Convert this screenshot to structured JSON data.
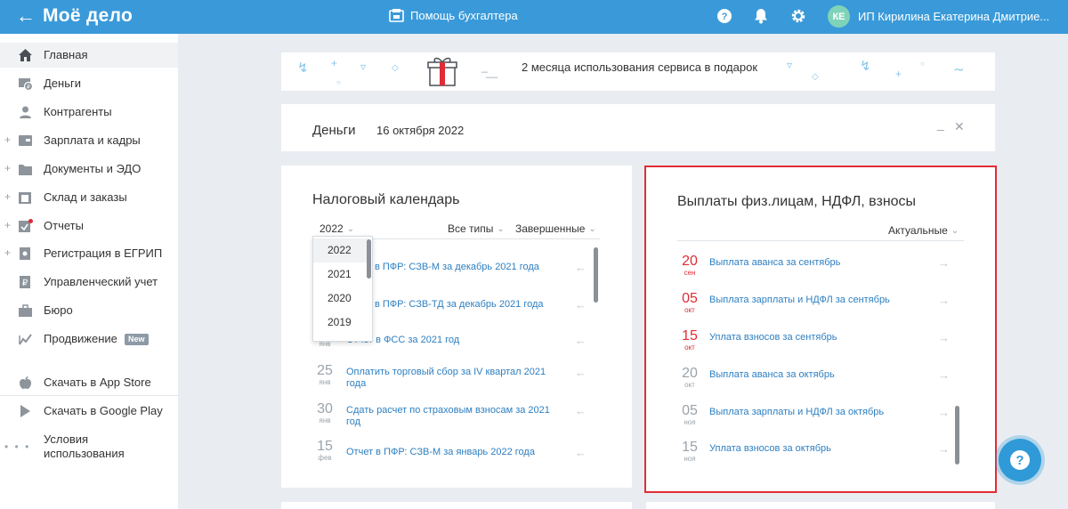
{
  "topbar": {
    "logo": "Моё дело",
    "helper_label": "Помощь бухгалтера",
    "user_initials": "КЕ",
    "user_name": "ИП Кирилина Екатерина Дмитрие..."
  },
  "sidebar": {
    "items": [
      {
        "label": "Главная"
      },
      {
        "label": "Деньги"
      },
      {
        "label": "Контрагенты"
      },
      {
        "label": "Зарплата и кадры"
      },
      {
        "label": "Документы и ЭДО"
      },
      {
        "label": "Склад и заказы"
      },
      {
        "label": "Отчеты"
      },
      {
        "label": "Регистрация в ЕГРИП"
      },
      {
        "label": "Управленческий учет"
      },
      {
        "label": "Бюро"
      },
      {
        "label": "Продвижение",
        "badge": "New"
      }
    ],
    "bottom_items": [
      {
        "label": "Скачать в App Store"
      },
      {
        "label": "Скачать в Google Play"
      },
      {
        "label_line1": "Условия",
        "label_line2": "использования"
      }
    ]
  },
  "banner": {
    "text": "2 месяца использования сервиса в подарок"
  },
  "money": {
    "title": "Деньги",
    "date": "16 октября 2022"
  },
  "tax_calendar": {
    "title": "Налоговый календарь",
    "year": "2022",
    "filter_types": "Все типы",
    "filter_status": "Завершенные",
    "year_options": [
      "2022",
      "2021",
      "2020",
      "2019"
    ],
    "rows": [
      {
        "text": "в ПФР: СЗВ-М за декабрь 2021 года"
      },
      {
        "text": "в ПФР: СЗВ-ТД за декабрь 2021 года"
      },
      {
        "month": "янв",
        "text": "Отчет в ФСС за 2021 год"
      },
      {
        "day": "25",
        "month": "янв",
        "text": "Оплатить торговый сбор за IV квартал 2021 года"
      },
      {
        "day": "30",
        "month": "янв",
        "text": "Сдать расчет по страховым взносам за 2021 год"
      },
      {
        "day": "15",
        "month": "фев",
        "text": "Отчет в ПФР: СЗВ-М за январь 2022 года"
      }
    ]
  },
  "payments": {
    "title": "Выплаты физ.лицам, НДФЛ, взносы",
    "filter": "Актуальные",
    "rows": [
      {
        "day": "20",
        "month": "сен",
        "text": "Выплата аванса за сентябрь"
      },
      {
        "day": "05",
        "month": "окт",
        "text": "Выплата зарплаты и НДФЛ за сентябрь"
      },
      {
        "day": "15",
        "month": "окт",
        "text": "Уплата взносов за сентябрь"
      },
      {
        "day": "20",
        "month": "окт",
        "text": "Выплата аванса за октябрь"
      },
      {
        "day": "05",
        "month": "ноя",
        "text": "Выплата зарплаты и НДФЛ за октябрь"
      },
      {
        "day": "15",
        "month": "ноя",
        "text": "Уплата взносов за октябрь"
      }
    ]
  },
  "colors": {
    "topbar": "#3a9ad9",
    "overdue": "#e02c35",
    "link": "#2d7fc1",
    "highlight": "#e02c35"
  },
  "icons": [
    "back-arrow-icon",
    "calculator-icon",
    "help-icon",
    "bell-icon",
    "gear-icon",
    "home-icon",
    "money-icon",
    "contacts-icon",
    "salary-icon",
    "documents-icon",
    "warehouse-icon",
    "reports-icon",
    "registration-icon",
    "management-icon",
    "bureau-icon",
    "promotion-icon",
    "apple-icon",
    "google-play-icon",
    "gift-icon",
    "minimize-icon",
    "close-icon",
    "chevron-down-icon",
    "arrow-right-icon",
    "arrow-left-icon"
  ]
}
